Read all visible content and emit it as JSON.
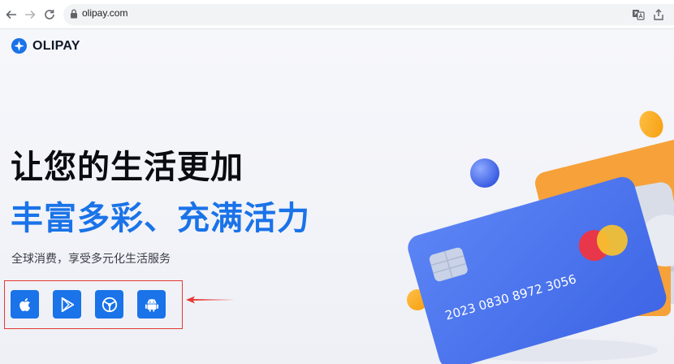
{
  "browser": {
    "url": "olipay.com",
    "icons": [
      "back-arrow-icon",
      "forward-arrow-icon",
      "reload-icon",
      "lock-icon",
      "translate-icon",
      "share-icon"
    ]
  },
  "brand": {
    "name": "OLIPAY",
    "accent_color": "#1a73e8"
  },
  "hero": {
    "headline_line1": "让您的生活更加",
    "headline_line2": "丰富多彩、充满活力",
    "subtitle": "全球消费，享受多元化生活服务",
    "card_number": "2023 0830 8972 3056"
  },
  "downloads": [
    {
      "platform": "apple",
      "icon": "apple-icon"
    },
    {
      "platform": "google-play",
      "icon": "google-play-icon"
    },
    {
      "platform": "web",
      "icon": "steering-wheel-icon"
    },
    {
      "platform": "android",
      "icon": "android-icon"
    }
  ],
  "annotation": {
    "color": "#e53935"
  }
}
